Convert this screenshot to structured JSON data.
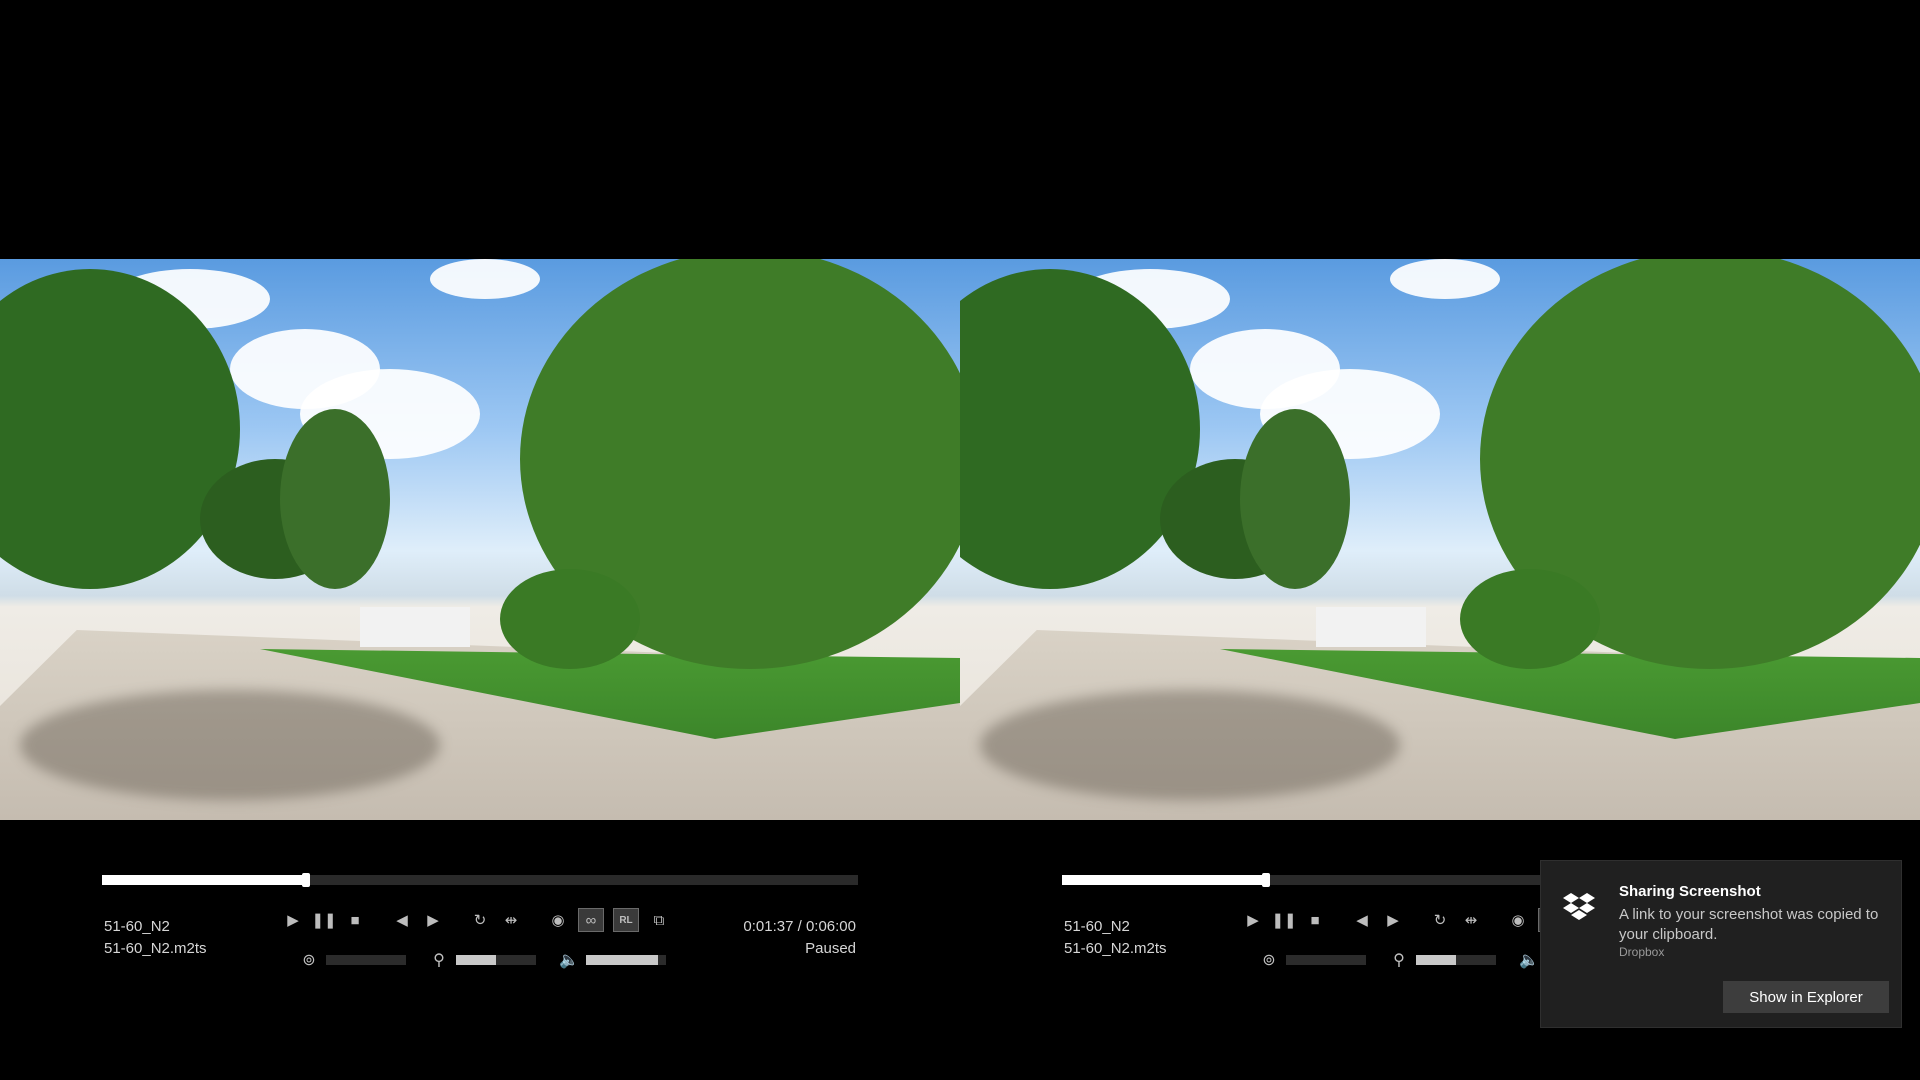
{
  "players": [
    {
      "title": "51-60_N2",
      "filename": "51-60_N2.m2ts",
      "time": "0:01:37 / 0:06:00",
      "status": "Paused",
      "progress": 0.27
    },
    {
      "title": "51-60_N2",
      "filename": "51-60_N2.m2ts",
      "progress": 0.27
    }
  ],
  "sliders": {
    "parallax": 0,
    "zoom": 0.5,
    "volume": 0.9
  },
  "toast": {
    "title": "Sharing Screenshot",
    "message": "A link to your screenshot was copied to your clipboard.",
    "app": "Dropbox",
    "button": "Show in Explorer"
  },
  "icons": [
    "play-icon",
    "pause-icon",
    "stop-icon",
    "prev-frame-icon",
    "next-frame-icon",
    "loop-icon",
    "swap-icon",
    "eye-icon",
    "3d-glasses-icon",
    "rl-swap-icon",
    "external-window-icon",
    "stereo-icon",
    "zoom-icon",
    "volume-icon",
    "dropbox-icon"
  ],
  "colors": {
    "background": "#000000",
    "seek_fill": "#ffffff",
    "toast_bg": "#202020"
  }
}
